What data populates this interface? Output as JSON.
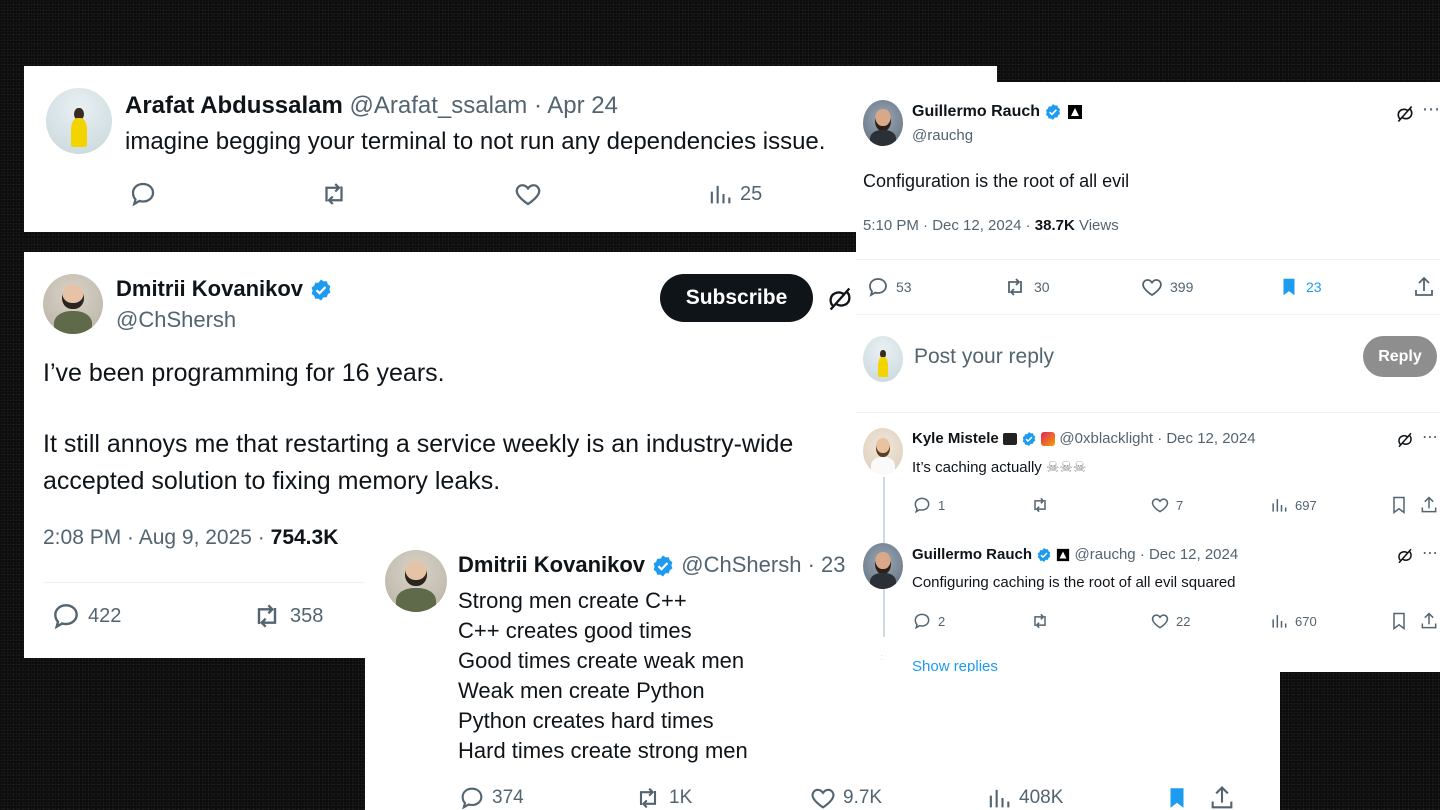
{
  "tweet1": {
    "name": "Arafat Abdussalam",
    "handle": "@Arafat_ssalam",
    "date": "· Apr 24",
    "text": "imagine begging your terminal to not run any dependencies issue.",
    "stats": {
      "views": "25"
    }
  },
  "tweet2": {
    "name": "Dmitrii Kovanikov",
    "handle": "@ChShersh",
    "subscribe_label": "Subscribe",
    "line1": "I’ve been programming for 16 years.",
    "line2": "It still annoys me that restarting a service weekly is an industry-wide",
    "line3": "accepted solution to fixing memory leaks.",
    "timestamp": "2:08 PM · Aug 9, 2025 · ",
    "views": "754.3K",
    "stats": {
      "replies": "422",
      "retweets": "358"
    }
  },
  "tweet3": {
    "name": "Dmitrii Kovanikov",
    "handle": "@ChShersh",
    "date": "· 23",
    "lines": [
      "Strong men create C++",
      "C++ creates good times",
      "Good times create weak men",
      "Weak men create Python",
      "Python creates hard times",
      "Hard times create strong men"
    ],
    "stats": {
      "replies": "374",
      "retweets": "1K",
      "likes": "9.7K",
      "views": "408K"
    },
    "colors": {
      "bookmark": "#1d9bf0"
    }
  },
  "tweet4": {
    "name": "Guillermo Rauch",
    "handle": "@rauchg",
    "text": "Configuration is the root of all evil",
    "timestamp": "5:10 PM · Dec 12, 2024 · ",
    "views": "38.7K",
    "views_label": " Views",
    "stats": {
      "replies": "53",
      "retweets": "30",
      "likes": "399",
      "bookmarks": "23"
    },
    "reply_placeholder": "Post your reply",
    "reply_button": "Reply"
  },
  "reply1": {
    "name": "Kyle Mistele",
    "handle": "@0xblacklight",
    "date": "· Dec 12, 2024",
    "text": "It’s caching actually",
    "emoji": "☠☠☠",
    "stats": {
      "replies": "1",
      "likes": "7",
      "views": "697"
    }
  },
  "reply2": {
    "name": "Guillermo Rauch",
    "handle": "@rauchg",
    "date": "· Dec 12, 2024",
    "text": "Configuring caching is the root of all evil squared",
    "stats": {
      "replies": "2",
      "likes": "22",
      "views": "670"
    },
    "show_replies": "Show replies"
  },
  "colors": {
    "accent": "#1d9bf0",
    "text": "#0f1419",
    "muted": "#536471"
  }
}
